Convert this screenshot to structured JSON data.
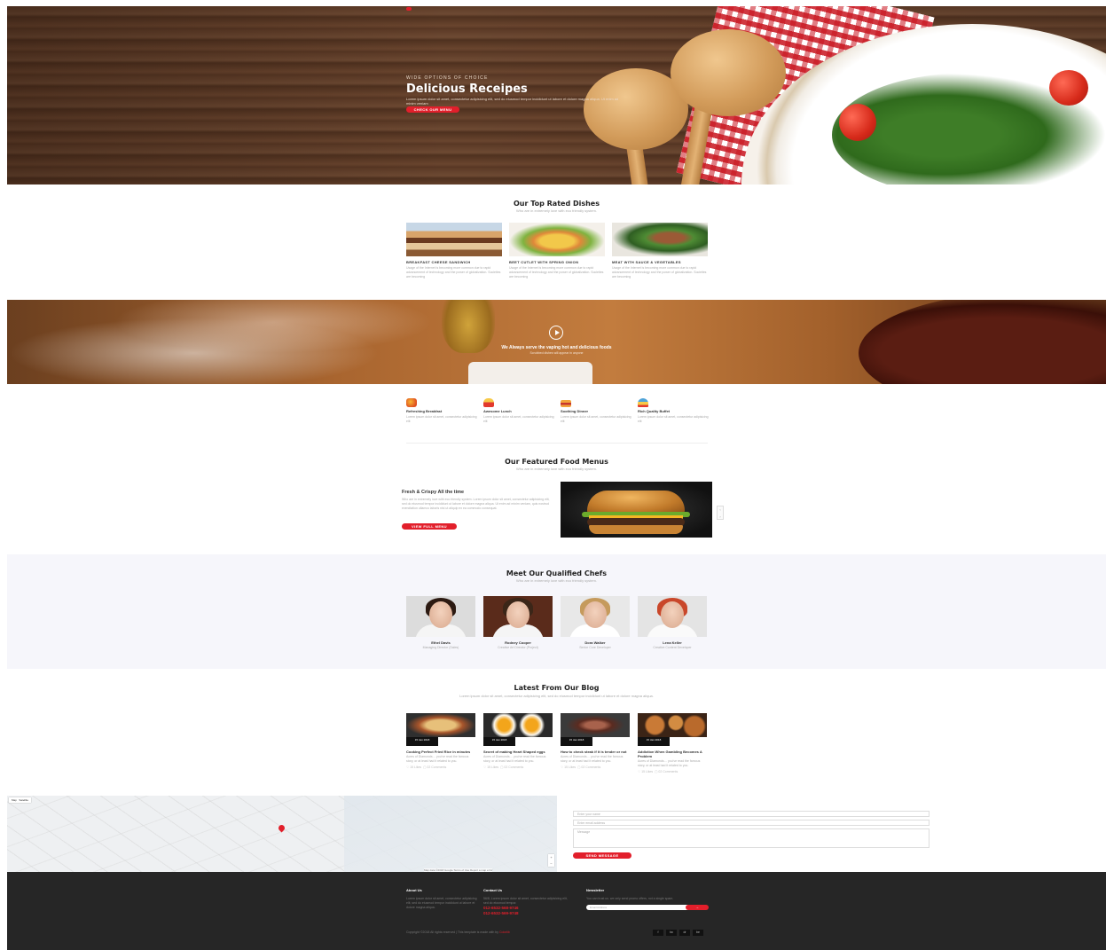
{
  "hero": {
    "eyebrow": "WIDE OPTIONS OF CHOICE",
    "title": "Delicious Receipes",
    "subtitle": "Lorem ipsum dolor sit amet, consectetur adipisicing elit, sed do eiusmod tempor incididunt ut labore et dolore magna aliqua. Ut enim ad minim veniam",
    "button": "CHECK OUR MENU"
  },
  "top_rated": {
    "title": "Our Top Rated Dishes",
    "subtitle": "Who are in extremely love with eco friendly system.",
    "dishes": [
      {
        "name": "BREAKFAST CHEESE SANDWICH",
        "desc": "Usage of the Internet is becoming more common due to rapid advancement of technology and the power of globalization. Societies are becoming"
      },
      {
        "name": "BEET CUTLET WITH SPRING ONION",
        "desc": "Usage of the Internet is becoming more common due to rapid advancement of technology and the power of globalization. Societies are becoming"
      },
      {
        "name": "MEAT WITH SAUCE & VEGETABLES",
        "desc": "Usage of the Internet is becoming more common due to rapid advancement of technology and the power of globalization. Societies are becoming"
      }
    ]
  },
  "video": {
    "title": "We Always serve the vaping hot and delicious foods",
    "subtitle": "Scrubbed dishes will appear in anyone"
  },
  "features": [
    {
      "title": "Refreshing Breakfast",
      "desc": "Lorem ipsum dolor sit amet, consectetur adipisicing elit"
    },
    {
      "title": "Awesome Lunch",
      "desc": "Lorem ipsum dolor sit amet, consectetur adipisicing elit"
    },
    {
      "title": "Soothing Dinner",
      "desc": "Lorem ipsum dolor sit amet, consectetur adipisicing elit"
    },
    {
      "title": "Rich Quality Buffet",
      "desc": "Lorem ipsum dolor sit amet, consectetur adipisicing elit"
    }
  ],
  "featured": {
    "title": "Our Featured Food Menus",
    "subtitle": "Who are in extremely love with eco friendly system.",
    "item_title": "Fresh & Crispy All the time",
    "item_desc": "Who are in extremely love with eco friendly system. Lorem ipsum dolor sit amet, consectetur adipisicing elit, sed do eiusmod tempor incididunt ut labore et dolore magna aliqua. Ut enim ad minim veniam, quis nostrud exercitation ullamco laboris nisi ut aliquip ex ea commodo consequat.",
    "button": "VIEW FULL MENU",
    "arrow_up": "‹",
    "arrow_down": "›"
  },
  "chefs": {
    "title": "Meet Our Qualified Chefs",
    "subtitle": "Who are in extremely love with eco friendly system.",
    "people": [
      {
        "name": "Ethel Davis",
        "role": "Managing Director (Sales)"
      },
      {
        "name": "Rodney Cooper",
        "role": "Creative Art Director (Project)"
      },
      {
        "name": "Dora Walker",
        "role": "Senior Core Developer"
      },
      {
        "name": "Lena Keller",
        "role": "Creative Content Developer"
      }
    ]
  },
  "blog": {
    "title": "Latest From Our Blog",
    "subtitle": "Lorem ipsum dolor sit amet, consectetur adipisicing elit, sed do eiusmod tempor incididunt ut labore et dolore magna aliqua.",
    "posts": [
      {
        "date": "15 Jan 2018",
        "title": "Cooking Perfect Fried Rice in minutes",
        "desc": "Acres of Diamonds… you've read the famous story, or at least had it related to you.",
        "likes": "15 Likes",
        "comments": "02 Comments"
      },
      {
        "date": "15 Jan 2018",
        "title": "Secret of making Heart Shaped eggs",
        "desc": "Acres of Diamonds… you've read the famous story, or at least had it related to you.",
        "likes": "15 Likes",
        "comments": "02 Comments"
      },
      {
        "date": "15 Jan 2018",
        "title": "How to check steak if it is tender or not",
        "desc": "Acres of Diamonds… you've read the famous story, or at least had it related to you.",
        "likes": "15 Likes",
        "comments": "02 Comments"
      },
      {
        "date": "15 Jan 2018",
        "title": "Addiction When Gambling Becomes A Problem",
        "desc": "Acres of Diamonds… you've read the famous story, or at least had it related to you.",
        "likes": "15 Likes",
        "comments": "02 Comments"
      }
    ]
  },
  "map": {
    "tab_map": "Map",
    "tab_sat": "Satellite",
    "attribution": "Map data ©2018 Google  Terms of Use  Report a map error",
    "zoom_in": "+",
    "zoom_out": "−"
  },
  "contact_form": {
    "name_placeholder": "Enter your name",
    "email_placeholder": "Enter email address",
    "message_placeholder": "Message",
    "button": "SEND MESSAGE"
  },
  "footer": {
    "about_title": "About Us",
    "about_text": "Lorem ipsum dolor sit amet, consectetur adipisicing elit, sed do eiusmod tempor incididunt ut labore et dolore magna aliqua.",
    "contact_title": "Contact Us",
    "contact_text": "56/8, Lorem ipsum dolor sit amet, consectetur adipisicing elit, sed do eiusmod tempor.",
    "phone1": "012-6532-568-9746",
    "phone2": "012-6532-569-9748",
    "newsletter_title": "Newsletter",
    "newsletter_text": "You can trust us. we only send promo offers, not a single spam.",
    "newsletter_placeholder": "Email Address",
    "newsletter_button": "→",
    "copyright": "Copyright ©2018 All rights reserved | This template is made with by",
    "copyright_link": "Colorlib",
    "social": [
      "f",
      "tw",
      "dr",
      "be"
    ]
  },
  "colors": {
    "accent": "#e21f2b",
    "footer_bg": "#262626",
    "chefs_bg": "#f6f6fb"
  }
}
